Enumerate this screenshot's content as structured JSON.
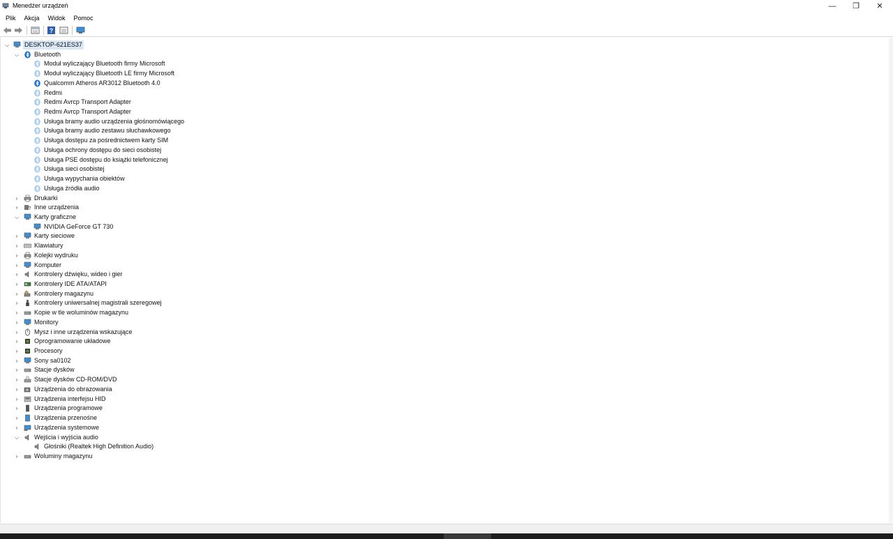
{
  "window": {
    "title": "Menedżer urządzeń",
    "minimize_glyph": "—",
    "maximize_glyph": "❐",
    "close_glyph": "✕"
  },
  "menu": [
    "Plik",
    "Akcja",
    "Widok",
    "Pomoc"
  ],
  "toolbar": {
    "icons": [
      "back-arrow-icon",
      "forward-arrow-icon",
      "properties-icon",
      "help-icon",
      "details-icon",
      "monitor-scan-icon"
    ]
  },
  "tree": {
    "root": "DESKTOP-621ES37",
    "items": [
      {
        "label": "Bluetooth",
        "level": 1,
        "state": "expanded",
        "icon": "bluetooth-icon"
      },
      {
        "label": "Moduł wyliczający Bluetooth firmy Microsoft",
        "level": 2,
        "state": "leaf",
        "icon": "bluetooth-device-icon"
      },
      {
        "label": "Moduł wyliczający Bluetooth LE firmy Microsoft",
        "level": 2,
        "state": "leaf",
        "icon": "bluetooth-device-icon"
      },
      {
        "label": "Qualcomm Atheros AR3012 Bluetooth 4.0",
        "level": 2,
        "state": "leaf",
        "icon": "bluetooth-icon"
      },
      {
        "label": "Redmi",
        "level": 2,
        "state": "leaf",
        "icon": "bluetooth-device-icon"
      },
      {
        "label": "Redmi Avrcp Transport Adapter",
        "level": 2,
        "state": "leaf",
        "icon": "bluetooth-device-icon"
      },
      {
        "label": "Redmi Avrcp Transport Adapter",
        "level": 2,
        "state": "leaf",
        "icon": "bluetooth-device-icon"
      },
      {
        "label": "Usługa bramy audio urządzenia głośnomówiącego",
        "level": 2,
        "state": "leaf",
        "icon": "bluetooth-device-icon"
      },
      {
        "label": "Usługa bramy audio zestawu słuchawkowego",
        "level": 2,
        "state": "leaf",
        "icon": "bluetooth-device-icon"
      },
      {
        "label": "Usługa dostępu za pośrednictwem karty SIM",
        "level": 2,
        "state": "leaf",
        "icon": "bluetooth-device-icon"
      },
      {
        "label": "Usługa ochrony dostępu do sieci osobistej",
        "level": 2,
        "state": "leaf",
        "icon": "bluetooth-device-icon"
      },
      {
        "label": "Usługa PSE dostępu do książki telefonicznej",
        "level": 2,
        "state": "leaf",
        "icon": "bluetooth-device-icon"
      },
      {
        "label": "Usługa sieci osobistej",
        "level": 2,
        "state": "leaf",
        "icon": "bluetooth-device-icon"
      },
      {
        "label": "Usługa wypychania obiektów",
        "level": 2,
        "state": "leaf",
        "icon": "bluetooth-device-icon"
      },
      {
        "label": "Usługa źródła audio",
        "level": 2,
        "state": "leaf",
        "icon": "bluetooth-device-icon"
      },
      {
        "label": "Drukarki",
        "level": 1,
        "state": "collapsed",
        "icon": "printer-icon"
      },
      {
        "label": "Inne urządzenia",
        "level": 1,
        "state": "collapsed",
        "icon": "unknown-device-icon"
      },
      {
        "label": "Karty graficzne",
        "level": 1,
        "state": "expanded",
        "icon": "display-adapter-icon"
      },
      {
        "label": "NVIDIA GeForce GT 730",
        "level": 2,
        "state": "leaf",
        "icon": "display-adapter-icon"
      },
      {
        "label": "Karty sieciowe",
        "level": 1,
        "state": "collapsed",
        "icon": "network-adapter-icon"
      },
      {
        "label": "Klawiatury",
        "level": 1,
        "state": "collapsed",
        "icon": "keyboard-icon"
      },
      {
        "label": "Kolejki wydruku",
        "level": 1,
        "state": "collapsed",
        "icon": "print-queue-icon"
      },
      {
        "label": "Komputer",
        "level": 1,
        "state": "collapsed",
        "icon": "computer-icon"
      },
      {
        "label": "Kontrolery dźwięku, wideo i gier",
        "level": 1,
        "state": "collapsed",
        "icon": "speaker-icon"
      },
      {
        "label": "Kontrolery IDE ATA/ATAPI",
        "level": 1,
        "state": "collapsed",
        "icon": "ide-controller-icon"
      },
      {
        "label": "Kontrolery magazynu",
        "level": 1,
        "state": "collapsed",
        "icon": "storage-controller-icon"
      },
      {
        "label": "Kontrolery uniwersalnej magistrali szeregowej",
        "level": 1,
        "state": "collapsed",
        "icon": "usb-icon"
      },
      {
        "label": "Kopie w tle woluminów magazynu",
        "level": 1,
        "state": "collapsed",
        "icon": "volume-shadow-icon"
      },
      {
        "label": "Monitory",
        "level": 1,
        "state": "collapsed",
        "icon": "monitor-icon"
      },
      {
        "label": "Mysz i inne urządzenia wskazujące",
        "level": 1,
        "state": "collapsed",
        "icon": "mouse-icon"
      },
      {
        "label": "Oprogramowanie układowe",
        "level": 1,
        "state": "collapsed",
        "icon": "firmware-icon"
      },
      {
        "label": "Procesory",
        "level": 1,
        "state": "collapsed",
        "icon": "processor-icon"
      },
      {
        "label": "Sony sa0102",
        "level": 1,
        "state": "collapsed",
        "icon": "monitor-icon"
      },
      {
        "label": "Stacje dysków",
        "level": 1,
        "state": "collapsed",
        "icon": "disk-drive-icon"
      },
      {
        "label": "Stacje dysków CD-ROM/DVD",
        "level": 1,
        "state": "collapsed",
        "icon": "cdrom-icon"
      },
      {
        "label": "Urządzenia do obrazowania",
        "level": 1,
        "state": "collapsed",
        "icon": "camera-icon"
      },
      {
        "label": "Urządzenia interfejsu HID",
        "level": 1,
        "state": "collapsed",
        "icon": "hid-icon"
      },
      {
        "label": "Urządzenia programowe",
        "level": 1,
        "state": "collapsed",
        "icon": "software-device-icon"
      },
      {
        "label": "Urządzenia przenośne",
        "level": 1,
        "state": "collapsed",
        "icon": "portable-device-icon"
      },
      {
        "label": "Urządzenia systemowe",
        "level": 1,
        "state": "collapsed",
        "icon": "system-device-icon"
      },
      {
        "label": "Wejścia i wyjścia audio",
        "level": 1,
        "state": "expanded",
        "icon": "speaker-icon"
      },
      {
        "label": "Głośniki (Realtek High Definition Audio)",
        "level": 2,
        "state": "leaf",
        "icon": "speaker-icon"
      },
      {
        "label": "Woluminy magazynu",
        "level": 1,
        "state": "collapsed",
        "icon": "disk-drive-icon"
      }
    ]
  },
  "colors": {
    "bluetooth": "#1e73d2",
    "bluetooth_light": "#a9cdf2",
    "monitor": "#3d8fd6",
    "selection": "#d9e8f7"
  }
}
